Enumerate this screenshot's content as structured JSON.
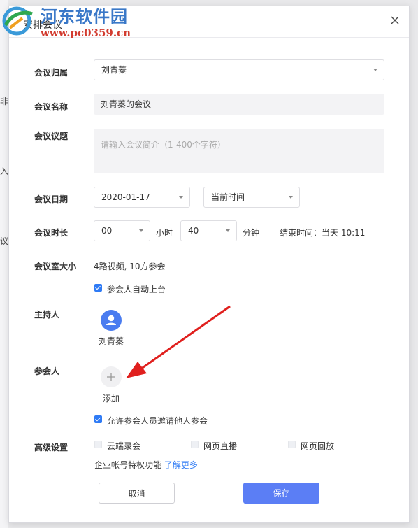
{
  "background": {
    "fragments": [
      "非",
      "入",
      "议"
    ]
  },
  "watermark": {
    "site_name": "河东软件园",
    "site_url": "www.pc0359.cn"
  },
  "dialog": {
    "title": "安排会议",
    "fields": {
      "owner": {
        "label": "会议归属",
        "value": "刘青蓁"
      },
      "name": {
        "label": "会议名称",
        "value": "刘青蓁的会议"
      },
      "topic": {
        "label": "会议议题",
        "placeholder": "请输入会议简介（1-400个字符）"
      },
      "date": {
        "label": "会议日期",
        "date_value": "2020-01-17",
        "time_value": "当前时间"
      },
      "duration": {
        "label": "会议时长",
        "hours": "00",
        "hours_unit": "小时",
        "minutes": "40",
        "minutes_unit": "分钟",
        "end_time": "结束时间：当天 10:11"
      },
      "max_size": {
        "label": "会议室大小",
        "value": "4路视频, 10方参会",
        "auto_stage_label": "参会人自动上台",
        "auto_stage_checked": true
      },
      "host": {
        "label": "主持人",
        "name": "刘青蓁"
      },
      "participants": {
        "label": "参会人",
        "add_label": "添加",
        "allow_invite_label": "允许参会人员邀请他人参会",
        "allow_invite_checked": true
      },
      "advanced": {
        "label": "高级设置",
        "options": [
          {
            "label": "云端录会",
            "checked": false
          },
          {
            "label": "网页直播",
            "checked": false
          },
          {
            "label": "网页回放",
            "checked": false
          }
        ],
        "enterprise_text": "企业帐号特权功能",
        "learn_more": "了解更多"
      }
    },
    "buttons": {
      "cancel": "取消",
      "save": "保存"
    }
  },
  "colors": {
    "accent": "#2f7bf5",
    "save_button": "#5b7ef5",
    "avatar": "#4a7cf0",
    "arrow": "#e0201e"
  }
}
